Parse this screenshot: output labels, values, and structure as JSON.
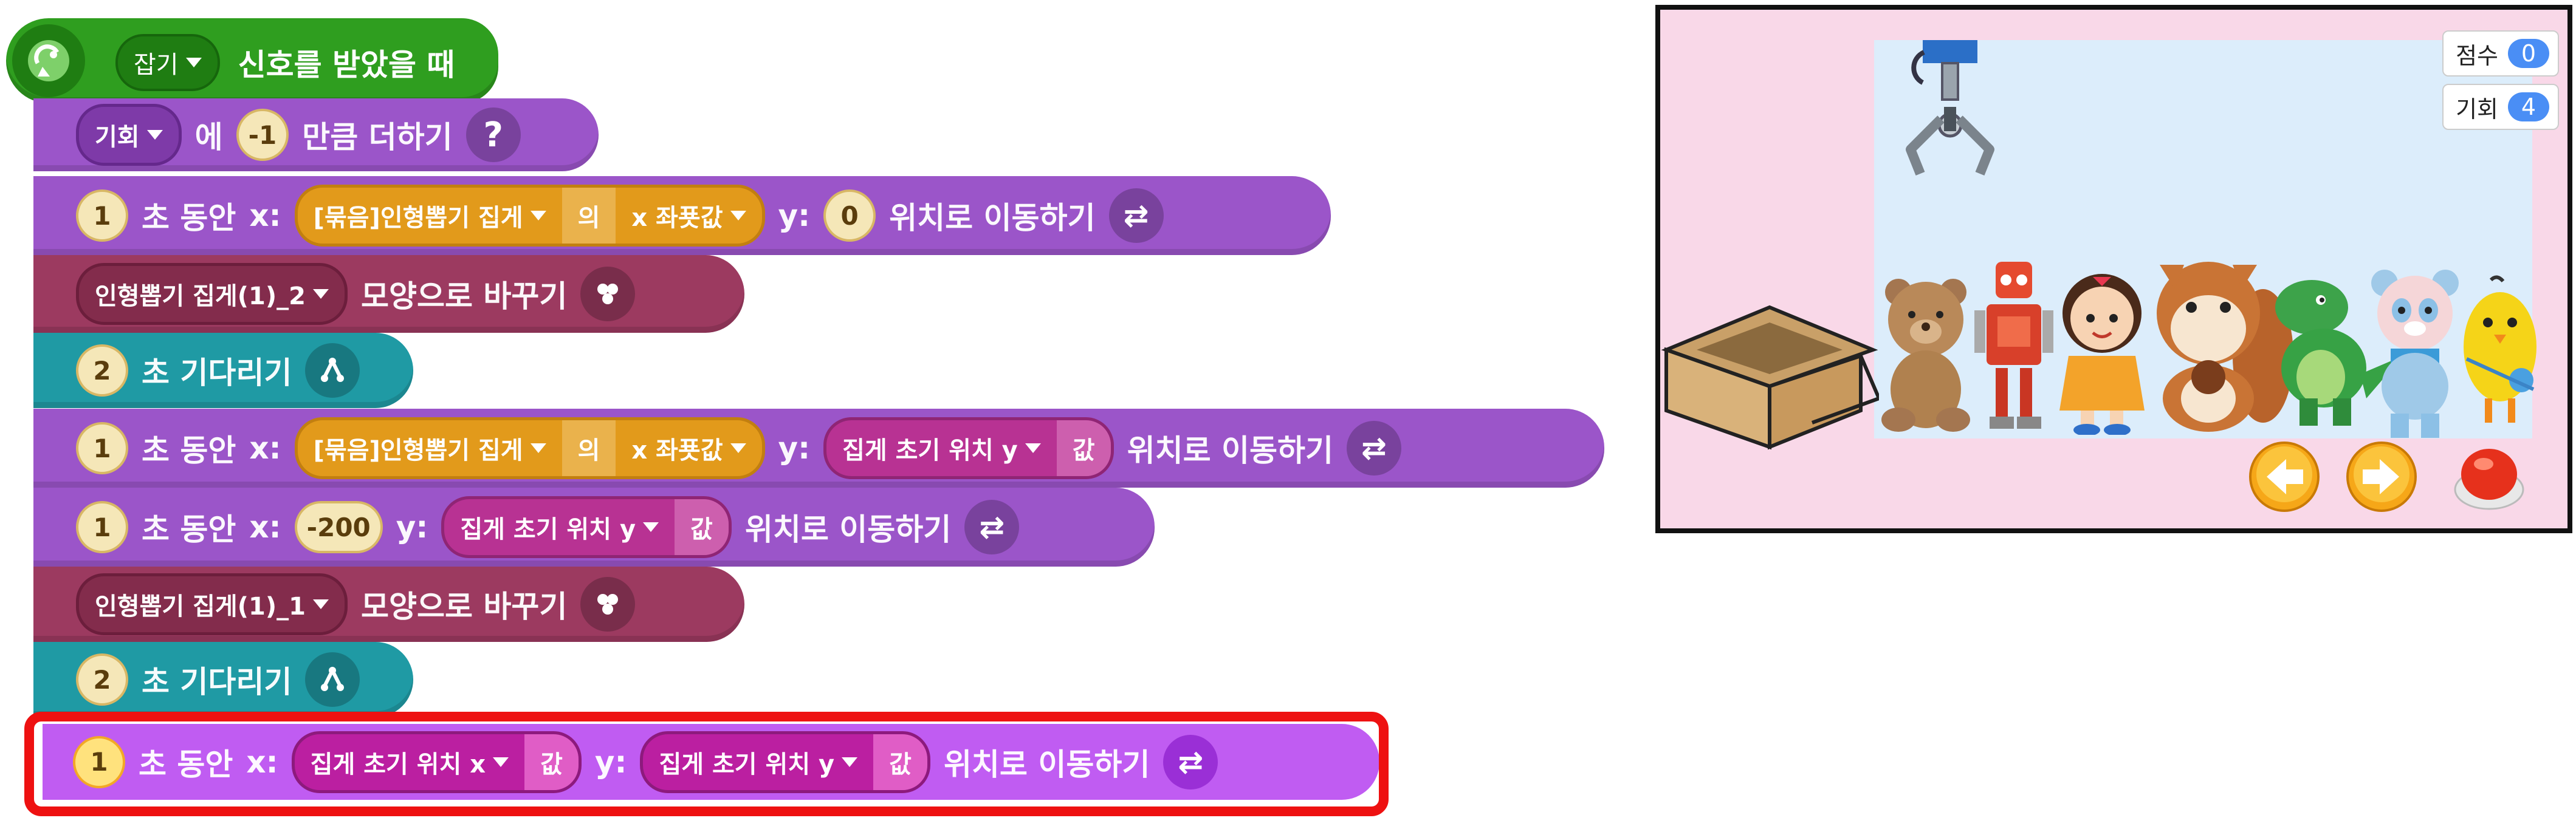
{
  "script": {
    "hat": {
      "dropdown": "잡기",
      "label": "신호를 받았을 때"
    },
    "blocks": [
      {
        "kind": "change",
        "var": "기회",
        "text_a": "에",
        "value": "-1",
        "text_b": "만큼 더하기"
      },
      {
        "kind": "glide_xy",
        "seconds": "1",
        "text_sec": "초 동안",
        "x_label": "x:",
        "x_object": "[묶음]인형뽑기 집게",
        "x_of": "의",
        "x_prop": "x 좌푯값",
        "y_label": "y:",
        "y_value": "0",
        "tail": "위치로 이동하기"
      },
      {
        "kind": "costume",
        "costume": "인형뽑기 집게(1)_2",
        "label": "모양으로 바꾸기"
      },
      {
        "kind": "wait",
        "seconds": "2",
        "label": "초 기다리기"
      },
      {
        "kind": "glide_xy_var",
        "seconds": "1",
        "text_sec": "초 동안",
        "x_label": "x:",
        "x_object": "[묶음]인형뽑기 집게",
        "x_of": "의",
        "x_prop": "x 좌푯값",
        "y_label": "y:",
        "y_var": "집게 초기 위치 y",
        "y_suffix": "값",
        "tail": "위치로 이동하기"
      },
      {
        "kind": "glide_num_var",
        "seconds": "1",
        "text_sec": "초 동안",
        "x_label": "x:",
        "x_value": "-200",
        "y_label": "y:",
        "y_var": "집게 초기 위치 y",
        "y_suffix": "값",
        "tail": "위치로 이동하기"
      },
      {
        "kind": "costume",
        "costume": "인형뽑기 집게(1)_1",
        "label": "모양으로 바꾸기"
      },
      {
        "kind": "wait",
        "seconds": "2",
        "label": "초 기다리기"
      },
      {
        "kind": "glide_var_var",
        "seconds": "1",
        "text_sec": "초 동안",
        "x_label": "x:",
        "x_var": "집게 초기 위치 x",
        "x_suffix": "값",
        "y_label": "y:",
        "y_var": "집게 초기 위치 y",
        "y_suffix": "값",
        "tail": "위치로 이동하기"
      }
    ]
  },
  "stage": {
    "score_label": "점수",
    "score_value": "0",
    "chances_label": "기회",
    "chances_value": "4"
  },
  "colors": {
    "hat": "#2f9e1f",
    "motion": "#9b55c9",
    "looks": "#9c3a60",
    "flow": "#1f9aa4",
    "highlight": "#ee1111",
    "stage_bg": "#f9d8e8",
    "stage_inner": "#dcedfb"
  },
  "icons": [
    "antenna-icon",
    "question-icon",
    "swap-arrows-icon",
    "looks-icon",
    "flow-icon",
    "claw-icon",
    "left-arrow-icon",
    "right-arrow-icon",
    "stop-icon"
  ]
}
